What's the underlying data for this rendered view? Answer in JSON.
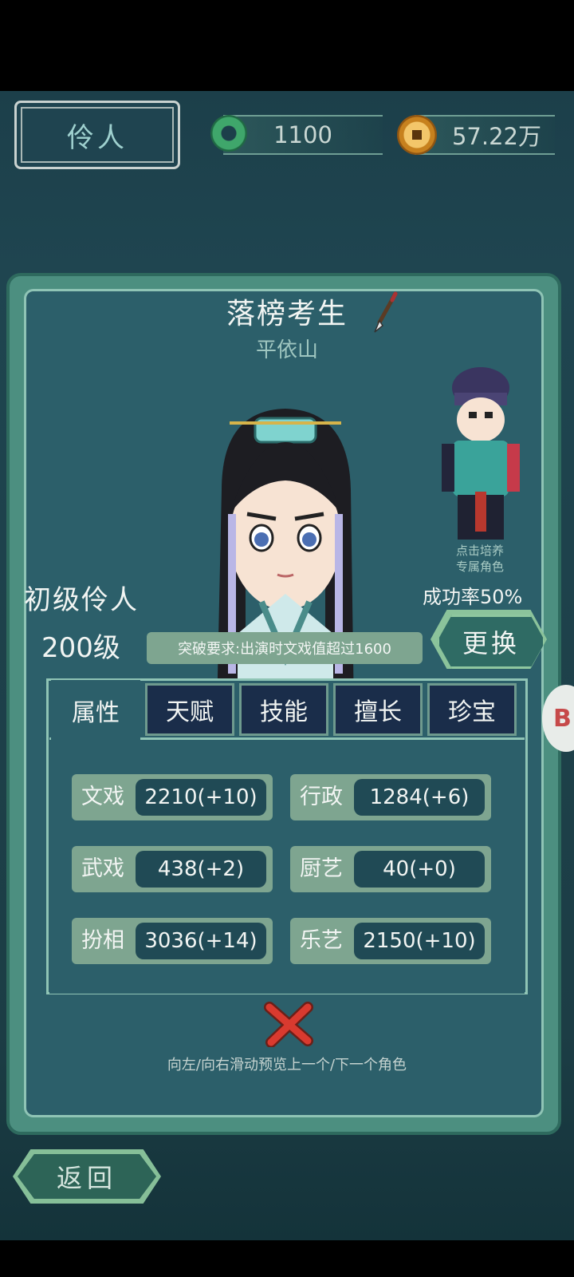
{
  "header": {
    "title": "伶人",
    "jade_amount": "1100",
    "coin_amount": "57.22万"
  },
  "character": {
    "role_title": "落榜考生",
    "name": "平依山",
    "rank": "初级伶人",
    "level": "200级",
    "breakthrough_requirement": "突破要求:出演时文戏值超过1600",
    "train_hint_line1": "点击培养",
    "train_hint_line2": "专属角色",
    "success_rate": "成功率50%",
    "swap_label": "更换"
  },
  "tabs": [
    {
      "label": "属性",
      "active": true
    },
    {
      "label": "天赋",
      "active": false
    },
    {
      "label": "技能",
      "active": false
    },
    {
      "label": "擅长",
      "active": false
    },
    {
      "label": "珍宝",
      "active": false
    }
  ],
  "stats": [
    {
      "label": "文戏",
      "value": "2210(+10)"
    },
    {
      "label": "行政",
      "value": "1284(+6)"
    },
    {
      "label": "武戏",
      "value": "438(+2)"
    },
    {
      "label": "厨艺",
      "value": "40(+0)"
    },
    {
      "label": "扮相",
      "value": "3036(+14)"
    },
    {
      "label": "乐艺",
      "value": "2150(+10)"
    }
  ],
  "hint": "向左/向右滑动预览上一个/下一个角色",
  "back_label": "返回",
  "side_handle_text": "B",
  "colors": {
    "panel_bg": "#2c5f6a",
    "panel_border": "#4c8f80",
    "stat_bg": "#7ea590",
    "stat_value_bg": "#204a55",
    "tab_inactive_bg": "#1a2d4a",
    "close_red": "#d93a2f"
  }
}
